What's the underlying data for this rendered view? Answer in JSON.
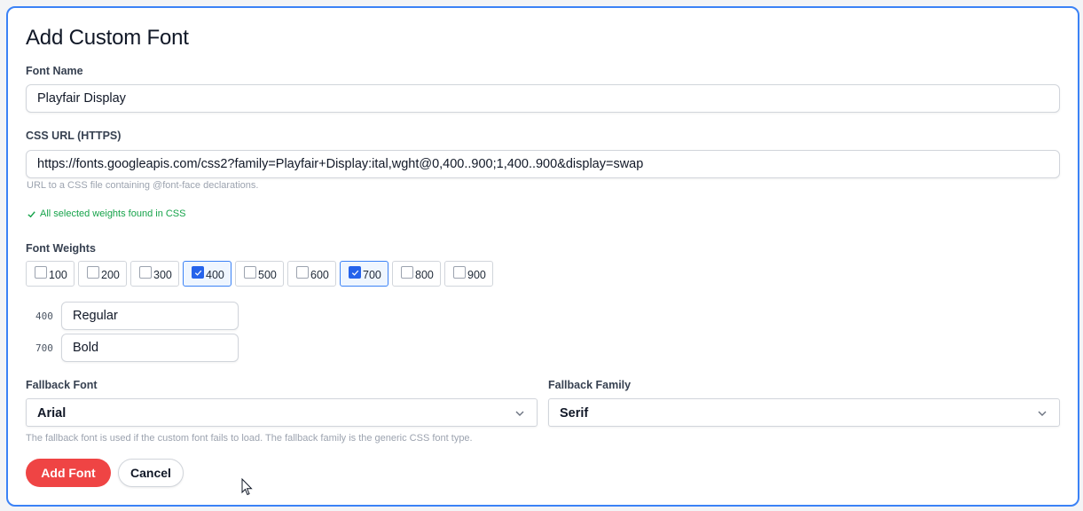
{
  "dialog": {
    "title": "Add Custom Font"
  },
  "font_name": {
    "label": "Font Name",
    "value": "Playfair Display"
  },
  "css_url": {
    "label": "CSS URL (HTTPS)",
    "value": "https://fonts.googleapis.com/css2?family=Playfair+Display:ital,wght@0,400..900;1,400..900&display=swap",
    "hint": "URL to a CSS file containing @font-face declarations.",
    "status": "All selected weights found in CSS"
  },
  "weights": {
    "label": "Font Weights",
    "options": [
      {
        "value": "100",
        "checked": false
      },
      {
        "value": "200",
        "checked": false
      },
      {
        "value": "300",
        "checked": false
      },
      {
        "value": "400",
        "checked": true
      },
      {
        "value": "500",
        "checked": false
      },
      {
        "value": "600",
        "checked": false
      },
      {
        "value": "700",
        "checked": true
      },
      {
        "value": "800",
        "checked": false
      },
      {
        "value": "900",
        "checked": false
      }
    ],
    "names": [
      {
        "weight": "400",
        "name": "Regular"
      },
      {
        "weight": "700",
        "name": "Bold"
      }
    ]
  },
  "fallback_font": {
    "label": "Fallback Font",
    "value": "Arial"
  },
  "fallback_family": {
    "label": "Fallback Family",
    "value": "Serif"
  },
  "fallback_hint": "The fallback font is used if the custom font fails to load. The fallback family is the generic CSS font type.",
  "actions": {
    "add_label": "Add Font",
    "cancel_label": "Cancel"
  },
  "colors": {
    "accent": "#3b82f6",
    "primary_button": "#ef4444",
    "success": "#16a34a",
    "checkbox_checked": "#2563eb"
  }
}
